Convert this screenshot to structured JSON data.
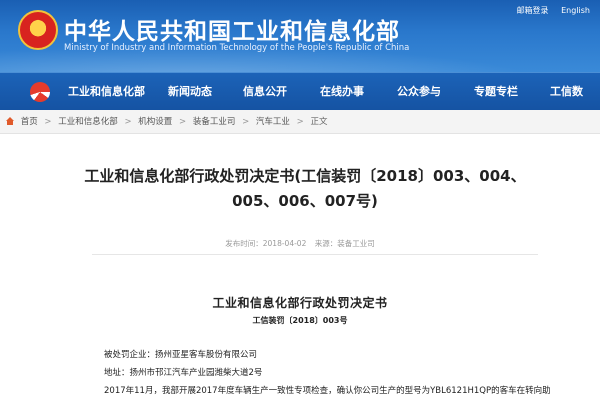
{
  "header": {
    "title": "中华人民共和国工业和信息化部",
    "subtitle": "Ministry of Industry and Information Technology of the People's Republic of China",
    "links": [
      "邮箱登录",
      "English"
    ],
    "emblem_icon": "national-emblem"
  },
  "nav": {
    "logo_icon": "miit-logo",
    "items": [
      "工业和信息化部",
      "新闻动态",
      "信息公开",
      "在线办事",
      "公众参与",
      "专题专栏",
      "工信数"
    ]
  },
  "breadcrumb": {
    "home_icon": "home-icon",
    "items": [
      "首页",
      "工业和信息化部",
      "机构设置",
      "装备工业司",
      "汽车工业",
      "正文"
    ],
    "separator": ">"
  },
  "article": {
    "title_line1": "工业和信息化部行政处罚决定书(工信装罚〔2018〕003、004、",
    "title_line2": "005、006、007号)",
    "publish_date": "发布时间：2018-04-02",
    "source": "来源：装备工业司",
    "doc_title": "工业和信息化部行政处罚决定书",
    "doc_number": "工信装罚〔2018〕003号",
    "party": "被处罚企业：扬州亚星客车股份有限公司",
    "address": "地址：扬州市邗江汽车产业园潍柴大道2号",
    "body_start": "2017年11月，我部开展2017年度车辆生产一致性专项检查，确认你公司生产的型号为YBL6121H1QP的客车在转向助"
  },
  "colors": {
    "header_blue": "#2a78cc",
    "nav_blue": "#1553a3",
    "emblem_red": "#d8231f",
    "emblem_gold": "#ffd24a"
  }
}
